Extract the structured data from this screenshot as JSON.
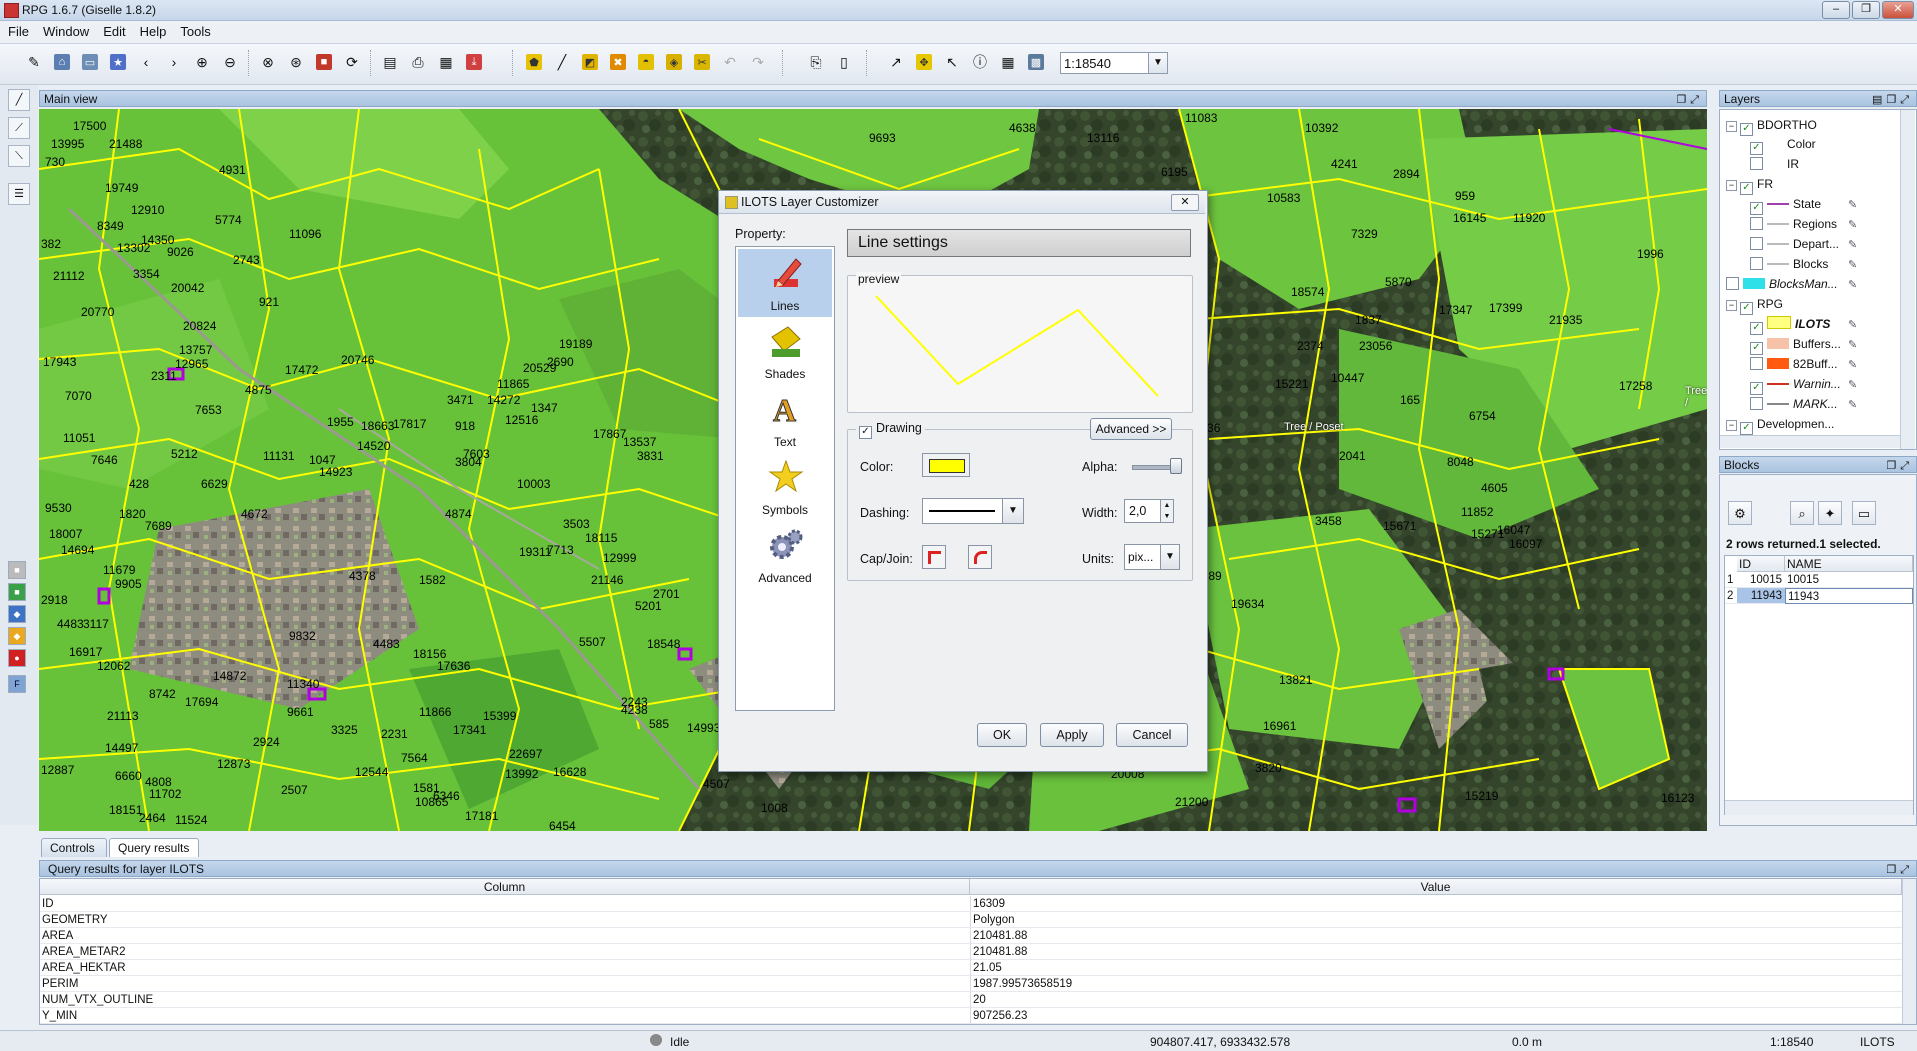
{
  "window": {
    "title": "RPG 1.6.7 (Giselle 1.8.2)",
    "controls": [
      "–",
      "❐",
      "✕"
    ]
  },
  "menu": [
    "File",
    "Window",
    "Edit",
    "Help",
    "Tools"
  ],
  "toolbar": {
    "scale_value": "1:18540"
  },
  "main_view": {
    "title": "Main view"
  },
  "map": {
    "parcel_labels": [
      {
        "t": "17500"
      },
      {
        "t": "13995"
      },
      {
        "t": "21488"
      },
      {
        "t": "730"
      },
      {
        "t": "4931"
      },
      {
        "t": "19749"
      },
      {
        "t": "12910"
      },
      {
        "t": "8349"
      },
      {
        "t": "5774"
      },
      {
        "t": "11096"
      },
      {
        "t": "382"
      },
      {
        "t": "13302"
      },
      {
        "t": "14350"
      },
      {
        "t": "9026"
      },
      {
        "t": "2743"
      },
      {
        "t": "21112"
      },
      {
        "t": "3354"
      },
      {
        "t": "20042"
      },
      {
        "t": "921"
      },
      {
        "t": "20770"
      },
      {
        "t": "20824"
      },
      {
        "t": "17943"
      },
      {
        "t": "13757"
      },
      {
        "t": "12965"
      },
      {
        "t": "2311"
      },
      {
        "t": "4875"
      },
      {
        "t": "17472"
      },
      {
        "t": "20746"
      },
      {
        "t": "7070"
      },
      {
        "t": "7653"
      },
      {
        "t": "1955"
      },
      {
        "t": "18663"
      },
      {
        "t": "17817"
      },
      {
        "t": "918"
      },
      {
        "t": "11051"
      },
      {
        "t": "5212"
      },
      {
        "t": "11131"
      },
      {
        "t": "1047"
      },
      {
        "t": "14923"
      },
      {
        "t": "14520"
      },
      {
        "t": "7646"
      },
      {
        "t": "428"
      },
      {
        "t": "6629"
      },
      {
        "t": "3804"
      },
      {
        "t": "7603"
      },
      {
        "t": "9530"
      },
      {
        "t": "1820"
      },
      {
        "t": "7689"
      },
      {
        "t": "4672"
      },
      {
        "t": "4874"
      },
      {
        "t": "10003"
      },
      {
        "t": "18007"
      },
      {
        "t": "14694"
      },
      {
        "t": "11679"
      },
      {
        "t": "9905"
      },
      {
        "t": "4378"
      },
      {
        "t": "2918"
      },
      {
        "t": "4483"
      },
      {
        "t": "3117"
      },
      {
        "t": "9832"
      },
      {
        "t": "4483"
      },
      {
        "t": "16917"
      },
      {
        "t": "12062"
      },
      {
        "t": "11340"
      },
      {
        "t": "18156"
      },
      {
        "t": "17636"
      },
      {
        "t": "8742"
      },
      {
        "t": "17694"
      },
      {
        "t": "14872"
      },
      {
        "t": "9661"
      },
      {
        "t": "21113"
      },
      {
        "t": "2924"
      },
      {
        "t": "3325"
      },
      {
        "t": "2231"
      },
      {
        "t": "11866"
      },
      {
        "t": "17341"
      },
      {
        "t": "15399"
      },
      {
        "t": "14497"
      },
      {
        "t": "6660"
      },
      {
        "t": "4808"
      },
      {
        "t": "12873"
      },
      {
        "t": "7564"
      },
      {
        "t": "22697"
      },
      {
        "t": "12887"
      },
      {
        "t": "11702"
      },
      {
        "t": "2507"
      },
      {
        "t": "12544"
      },
      {
        "t": "1581"
      },
      {
        "t": "10865"
      },
      {
        "t": "6346"
      },
      {
        "t": "13992"
      },
      {
        "t": "16628"
      },
      {
        "t": "18151"
      },
      {
        "t": "2464"
      },
      {
        "t": "11524"
      },
      {
        "t": "17181"
      },
      {
        "t": "6454"
      },
      {
        "t": "19189"
      },
      {
        "t": "2690"
      },
      {
        "t": "20529"
      },
      {
        "t": "11865"
      },
      {
        "t": "14272"
      },
      {
        "t": "3471"
      },
      {
        "t": "12516"
      },
      {
        "t": "1347"
      },
      {
        "t": "17867"
      },
      {
        "t": "13537"
      },
      {
        "t": "3831"
      },
      {
        "t": "3503"
      },
      {
        "t": "18115"
      },
      {
        "t": "7713"
      },
      {
        "t": "19311"
      },
      {
        "t": "12999"
      },
      {
        "t": "21146"
      },
      {
        "t": "1582"
      },
      {
        "t": "2701"
      },
      {
        "t": "5201"
      },
      {
        "t": "18548"
      },
      {
        "t": "5507"
      },
      {
        "t": "2243"
      },
      {
        "t": "4238"
      },
      {
        "t": "585"
      },
      {
        "t": "14993"
      },
      {
        "t": "4507"
      },
      {
        "t": "1008"
      },
      {
        "t": "9693"
      },
      {
        "t": "4638"
      },
      {
        "t": "13116"
      },
      {
        "t": "11083"
      },
      {
        "t": "6195"
      },
      {
        "t": "10392"
      },
      {
        "t": "4241"
      },
      {
        "t": "2894"
      },
      {
        "t": "10583"
      },
      {
        "t": "959"
      },
      {
        "t": "16145"
      },
      {
        "t": "11920"
      },
      {
        "t": "7329"
      },
      {
        "t": "1996"
      },
      {
        "t": "18574"
      },
      {
        "t": "5870"
      },
      {
        "t": "17347"
      },
      {
        "t": "17399"
      },
      {
        "t": "1837"
      },
      {
        "t": "21935"
      },
      {
        "t": "2374"
      },
      {
        "t": "23056"
      },
      {
        "t": "17258"
      },
      {
        "t": "15221"
      },
      {
        "t": "10447"
      },
      {
        "t": "165"
      },
      {
        "t": "6754"
      },
      {
        "t": "10136"
      },
      {
        "t": "2041"
      },
      {
        "t": "8048"
      },
      {
        "t": "4605"
      },
      {
        "t": "3458"
      },
      {
        "t": "15671"
      },
      {
        "t": "11852"
      },
      {
        "t": "6001"
      },
      {
        "t": "15271"
      },
      {
        "t": "16047"
      },
      {
        "t": "16097"
      },
      {
        "t": "3449"
      },
      {
        "t": "1689"
      },
      {
        "t": "19634"
      },
      {
        "t": "13821"
      },
      {
        "t": "2040"
      },
      {
        "t": "16961"
      },
      {
        "t": "3820"
      },
      {
        "t": "20008"
      },
      {
        "t": "21200"
      },
      {
        "t": "15219"
      },
      {
        "t": "16123"
      }
    ],
    "annotations": [
      {
        "t": "Tree / Poset"
      },
      {
        "t": "Tree / Poset"
      },
      {
        "t": "Tree / Poset"
      },
      {
        "t": "Tree /"
      }
    ]
  },
  "dialog": {
    "title": "ILOTS Layer Customizer",
    "property_label": "Property:",
    "properties": [
      "Lines",
      "Shades",
      "Text",
      "Symbols",
      "Advanced"
    ],
    "section_title": "Line settings",
    "preview_label": "preview",
    "drawing_label": "Drawing",
    "advanced_button": "Advanced >>",
    "color_label": "Color:",
    "alpha_label": "Alpha:",
    "dashing_label": "Dashing:",
    "width_label": "Width:",
    "width_value": "2,0",
    "capjoin_label": "Cap/Join:",
    "units_label": "Units:",
    "units_value": "pix...",
    "ok": "OK",
    "apply": "Apply",
    "cancel": "Cancel",
    "line_color": "#ffff00"
  },
  "layers": {
    "title": "Layers",
    "items": [
      {
        "label": "BDORTHO",
        "checked": true
      },
      {
        "label": "Color",
        "checked": true
      },
      {
        "label": "IR",
        "checked": false
      },
      {
        "label": "FR",
        "checked": true
      },
      {
        "label": "State",
        "checked": true
      },
      {
        "label": "Regions",
        "checked": false
      },
      {
        "label": "Depart...",
        "checked": false
      },
      {
        "label": "Blocks",
        "checked": false
      },
      {
        "label": "BlocksMan...",
        "checked": false
      },
      {
        "label": "RPG",
        "checked": true
      },
      {
        "label": "ILOTS",
        "checked": true
      },
      {
        "label": "Buffers...",
        "checked": true
      },
      {
        "label": "82Buff...",
        "checked": false
      },
      {
        "label": "Warnin...",
        "checked": true
      },
      {
        "label": "MARK...",
        "checked": false
      },
      {
        "label": "Developmen...",
        "checked": true
      }
    ]
  },
  "blocks": {
    "title": "Blocks",
    "summary": "2 rows returned.1 selected.",
    "columns": [
      "ID",
      "NAME"
    ],
    "rows": [
      {
        "n": "1",
        "id": "10015",
        "name": "10015"
      },
      {
        "n": "2",
        "id": "11943",
        "name": "11943"
      }
    ]
  },
  "bottom_tabs": [
    "Controls",
    "Query results"
  ],
  "query": {
    "title": "Query results for layer ILOTS",
    "columns": [
      "Column",
      "Value"
    ],
    "rows": [
      {
        "c": "ID",
        "v": "16309"
      },
      {
        "c": "GEOMETRY",
        "v": "Polygon"
      },
      {
        "c": "AREA",
        "v": "210481.88"
      },
      {
        "c": "AREA_METAR2",
        "v": "210481.88"
      },
      {
        "c": "AREA_HEKTAR",
        "v": "21.05"
      },
      {
        "c": "PERIM",
        "v": "1987.99573658519"
      },
      {
        "c": "NUM_VTX_OUTLINE",
        "v": "20"
      },
      {
        "c": "Y_MIN",
        "v": "907256.23"
      }
    ]
  },
  "status": {
    "state": "Idle",
    "coords": "904807.417, 6933432.578",
    "distance": "0.0 m",
    "scale": "1:18540",
    "layer": "ILOTS"
  }
}
